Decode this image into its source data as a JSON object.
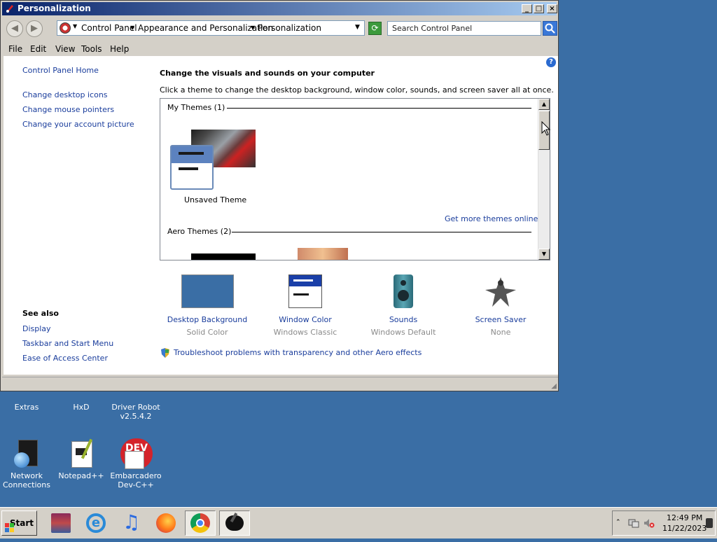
{
  "window": {
    "title": "Personalization",
    "address": [
      "Control Panel",
      "Appearance and Personalization",
      "Personalization"
    ],
    "search_placeholder": "Search Control Panel"
  },
  "menu": [
    "File",
    "Edit",
    "View",
    "Tools",
    "Help"
  ],
  "sidebar": {
    "home": "Control Panel Home",
    "links": [
      "Change desktop icons",
      "Change mouse pointers",
      "Change your account picture"
    ],
    "see_also_title": "See also",
    "see_also": [
      "Display",
      "Taskbar and Start Menu",
      "Ease of Access Center"
    ]
  },
  "main": {
    "heading": "Change the visuals and sounds on your computer",
    "description": "Click a theme to change the desktop background, window color, sounds, and screen saver all at once.",
    "my_themes_label": "My Themes (1)",
    "unsaved_theme": "Unsaved Theme",
    "get_more": "Get more themes online",
    "aero_themes_label": "Aero Themes (2)",
    "settings": [
      {
        "label": "Desktop Background",
        "sub": "Solid Color",
        "icon": "desktop-background-icon"
      },
      {
        "label": "Window Color",
        "sub": "Windows Classic",
        "icon": "window-color-icon"
      },
      {
        "label": "Sounds",
        "sub": "Windows Default",
        "icon": "speaker-icon"
      },
      {
        "label": "Screen Saver",
        "sub": "None",
        "icon": "screen-saver-icon"
      }
    ],
    "troubleshoot": "Troubleshoot problems with transparency and other Aero effects"
  },
  "desktop_icons": [
    {
      "label": "Extras"
    },
    {
      "label": "HxD"
    },
    {
      "label": "Driver Robot v2.5.4.2"
    },
    {
      "label": "Network Connections"
    },
    {
      "label": "Notepad++"
    },
    {
      "label": "Embarcadero Dev-C++"
    }
  ],
  "taskbar": {
    "start": "Start",
    "time": "12:49 PM",
    "date": "11/22/2023"
  },
  "colors": {
    "desktop": "#3a6ea5",
    "link": "#1a3d9c",
    "titlebar": "#0a246a"
  }
}
